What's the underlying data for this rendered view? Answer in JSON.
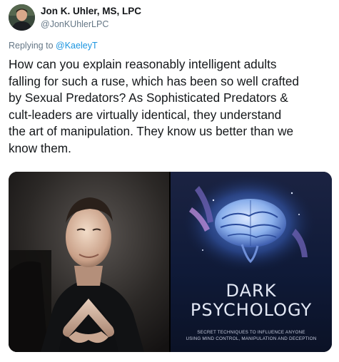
{
  "author": {
    "name": "Jon K. Uhler, MS, LPC",
    "handle": "@JonKUhlerLPC"
  },
  "reply": {
    "prefix": "Replying to",
    "mention": "@KaeleyT"
  },
  "tweet": {
    "lines": [
      "How can you explain reasonably intelligent adults",
      "falling for such a ruse, which has been so well crafted",
      "by Sexual Predators? As Sophisticated Predators &",
      "cult-leaders are virtually identical, they understand",
      "the art of manipulation. They know us better than we",
      "know them."
    ]
  },
  "media": {
    "book": {
      "title_line1": "DARK",
      "title_line2": "PSYCHOLOGY",
      "subtitle_line1": "SECRET TECHNIQUES TO INFLUENCE ANYONE",
      "subtitle_line2": "USING MIND CONTROL, MANIPULATION AND DECEPTION"
    }
  },
  "icons": {
    "avatar": "profile-photo",
    "portrait": "man-portrait-photo",
    "book_cover": "brain-book-cover"
  },
  "colors": {
    "link": "#1b95e0",
    "secondary_text": "#657786",
    "primary_text": "#14171a"
  }
}
